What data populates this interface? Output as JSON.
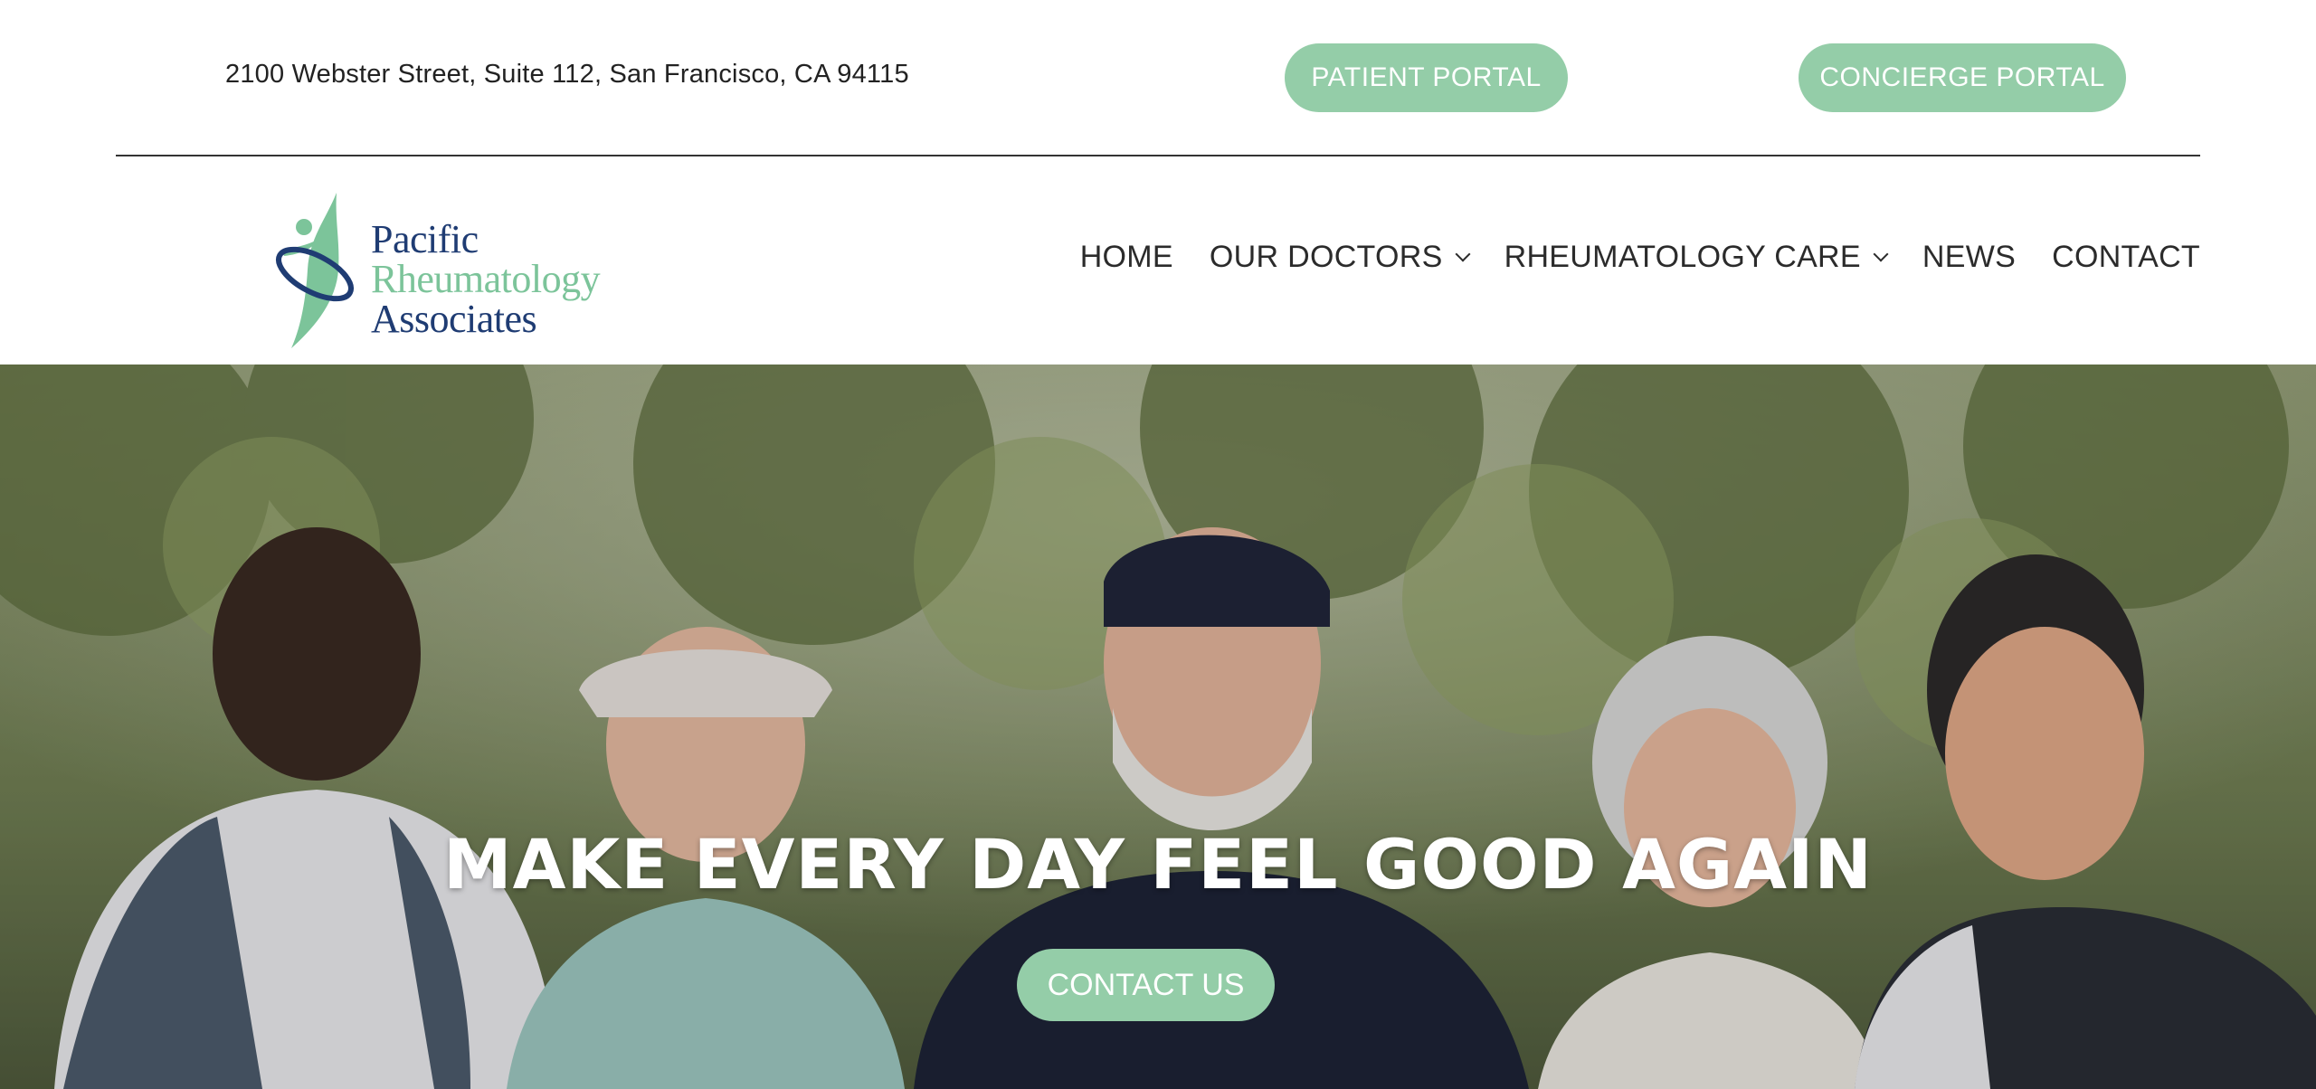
{
  "topbar": {
    "address": "2100 Webster Street, Suite 112, San Francisco, CA 94115",
    "patient_portal": "PATIENT PORTAL",
    "concierge_portal": "CONCIERGE PORTAL"
  },
  "logo": {
    "line1": "Pacific",
    "line2": "Rheumatology",
    "line3": "Associates"
  },
  "nav": {
    "items": [
      {
        "label": "HOME",
        "has_dropdown": false
      },
      {
        "label": "OUR DOCTORS",
        "has_dropdown": true
      },
      {
        "label": "RHEUMATOLOGY CARE",
        "has_dropdown": true
      },
      {
        "label": "NEWS",
        "has_dropdown": false
      },
      {
        "label": "CONTACT",
        "has_dropdown": false
      }
    ]
  },
  "hero": {
    "title": "MAKE EVERY DAY FEEL GOOD AGAIN",
    "cta": "CONTACT US"
  },
  "colors": {
    "accent_green": "#94cda8",
    "brand_navy": "#1f3c73",
    "brand_green": "#7cc49a",
    "text_dark": "#2b2b2b"
  }
}
